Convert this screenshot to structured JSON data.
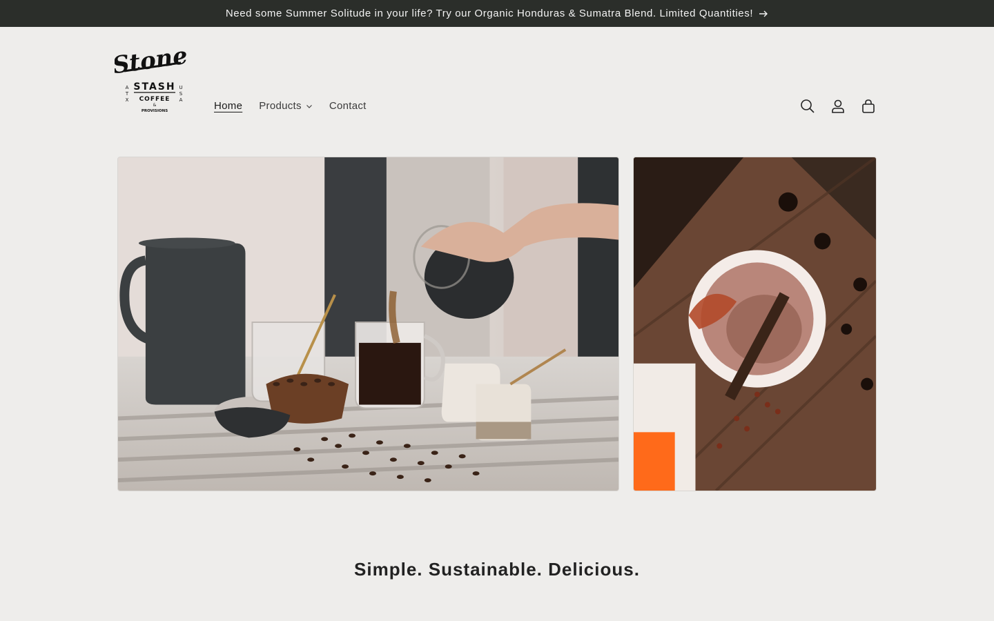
{
  "announcement": {
    "text": "Need some Summer Solitude in your life? Try our Organic Honduras & Sumatra Blend. Limited Quantities!",
    "arrow_icon": "arrow-right-icon"
  },
  "logo": {
    "script": "Stone",
    "name": "STASH",
    "sub1": "COFFEE",
    "sub2": "&",
    "sub3": "PROVISIONS",
    "left_letters": "ATX",
    "right_letters": "USA"
  },
  "nav": {
    "home": "Home",
    "products": "Products",
    "contact": "Contact"
  },
  "icons": {
    "search": "search-icon",
    "account": "account-icon",
    "cart": "cart-icon"
  },
  "tagline": "Simple. Sustainable. Delicious.",
  "colors": {
    "background": "#eeedeb",
    "announcement_bg": "#2b2e2a"
  }
}
